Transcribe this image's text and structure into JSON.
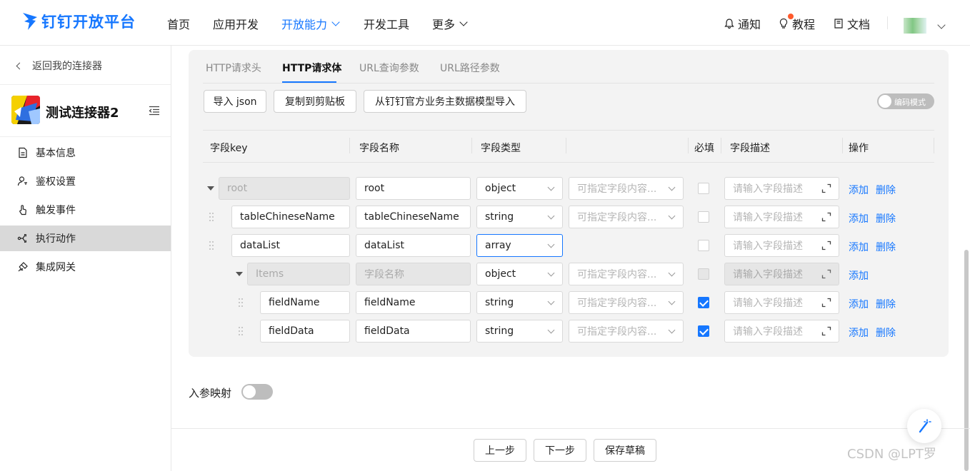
{
  "header": {
    "logo_text": "钉钉开放平台",
    "nav": [
      {
        "label": "首页"
      },
      {
        "label": "应用开发"
      },
      {
        "label": "开放能力",
        "active": true
      },
      {
        "label": "开发工具"
      },
      {
        "label": "更多"
      }
    ],
    "right": {
      "notify": "通知",
      "tutorial": "教程",
      "docs": "文档"
    },
    "accent": "#1677ff"
  },
  "sidebar": {
    "back_label": "返回我的连接器",
    "connector_name": "测试连接器2",
    "items": [
      {
        "label": "基本信息",
        "icon": "document-icon"
      },
      {
        "label": "鉴权设置",
        "icon": "user-key-icon"
      },
      {
        "label": "触发事件",
        "icon": "touch-icon"
      },
      {
        "label": "执行动作",
        "icon": "action-icon",
        "active": true
      },
      {
        "label": "集成网关",
        "icon": "gateway-icon"
      }
    ]
  },
  "tabs": [
    "HTTP请求头",
    "HTTP请求体",
    "URL查询参数",
    "URL路径参数"
  ],
  "active_tab": "HTTP请求体",
  "toolbar": {
    "import_json": "导入 json",
    "copy": "复制到剪贴板",
    "import_model": "从钉钉官方业务主数据模型导入",
    "code_mode": "编码模式",
    "code_mode_on": false
  },
  "table": {
    "headers": {
      "key": "字段key",
      "name": "字段名称",
      "type": "字段类型",
      "required": "必填",
      "desc": "字段描述",
      "ops": "操作"
    },
    "content_placeholder": "可指定字段内容...",
    "desc_placeholder": "请输入字段描述",
    "name_placeholder": "字段名称",
    "add": "添加",
    "delete": "删除",
    "rows": [
      {
        "key": "root",
        "name": "root",
        "type": "object",
        "required": false
      },
      {
        "key": "tableChineseName",
        "name": "tableChineseName",
        "type": "string",
        "required": false
      },
      {
        "key": "dataList",
        "name": "dataList",
        "type": "array",
        "required": false
      },
      {
        "key": "Items",
        "name": "",
        "type": "object",
        "required": false
      },
      {
        "key": "fieldName",
        "name": "fieldName",
        "type": "string",
        "required": true
      },
      {
        "key": "fieldData",
        "name": "fieldData",
        "type": "string",
        "required": true
      }
    ]
  },
  "mapping": {
    "label": "入参映射",
    "enabled": false
  },
  "footer": {
    "prev": "上一步",
    "next": "下一步",
    "save_draft": "保存草稿"
  },
  "watermark": "CSDN @LPT罗"
}
